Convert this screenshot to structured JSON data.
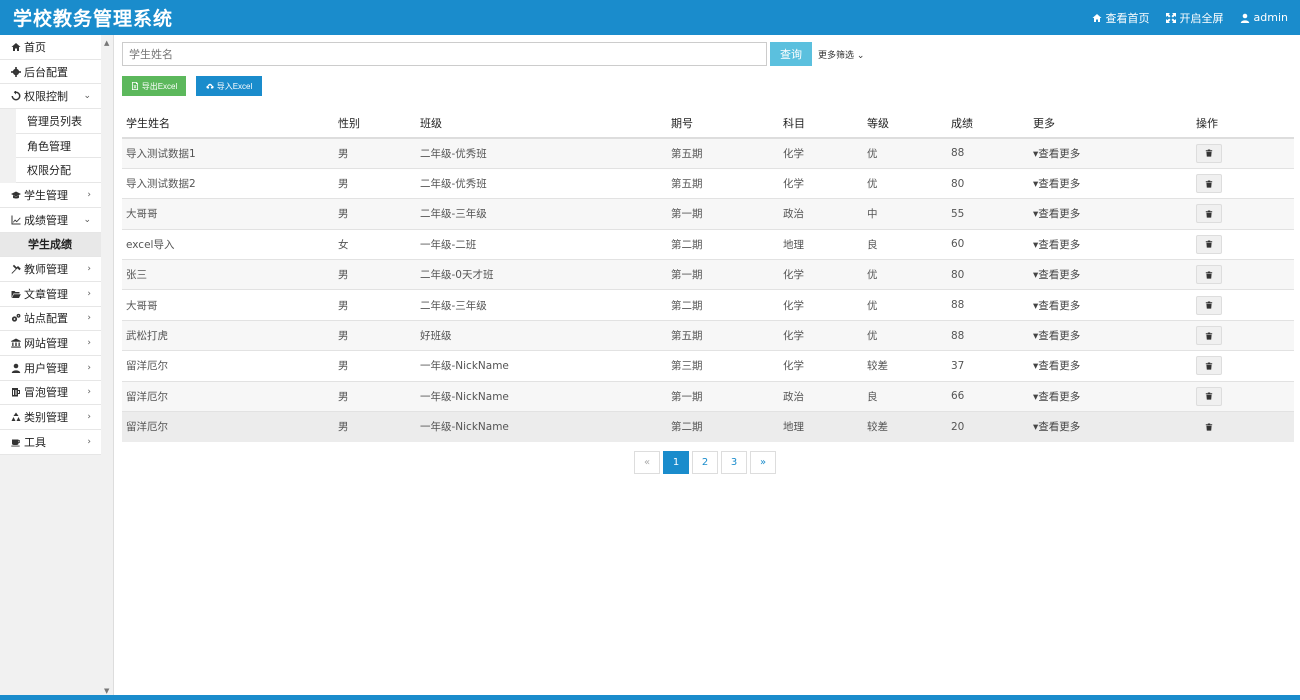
{
  "app": {
    "title": "学校教务管理系统"
  },
  "header": {
    "home_label": "查看首页",
    "fullscreen_label": "开启全屏",
    "user_label": "admin"
  },
  "sidebar": {
    "items": [
      {
        "label": "首页",
        "icon": "home-icon",
        "chevron": ""
      },
      {
        "label": "后台配置",
        "icon": "gear-icon",
        "chevron": ""
      },
      {
        "label": "权限控制",
        "icon": "recycle-icon",
        "chevron": "⌄"
      },
      {
        "label": "学生管理",
        "icon": "graduation-cap-icon",
        "chevron": "›"
      },
      {
        "label": "成绩管理",
        "icon": "line-chart-icon",
        "chevron": "⌄"
      },
      {
        "label": "教师管理",
        "icon": "gavel-icon",
        "chevron": "›"
      },
      {
        "label": "文章管理",
        "icon": "folder-open-icon",
        "chevron": "›"
      },
      {
        "label": "站点配置",
        "icon": "cogs-icon",
        "chevron": "›"
      },
      {
        "label": "网站管理",
        "icon": "bank-icon",
        "chevron": "›"
      },
      {
        "label": "用户管理",
        "icon": "user-icon",
        "chevron": "›"
      },
      {
        "label": "冒泡管理",
        "icon": "beer-icon",
        "chevron": "›"
      },
      {
        "label": "类别管理",
        "icon": "recycle-icon",
        "chevron": "›"
      },
      {
        "label": "工具",
        "icon": "coffee-icon",
        "chevron": "›"
      }
    ],
    "perm_sub": [
      "管理员列表",
      "角色管理",
      "权限分配"
    ],
    "score_sub": [
      "学生成绩"
    ]
  },
  "search": {
    "placeholder": "学生姓名",
    "query_label": "查询",
    "more_filter_label": "更多筛选 ⌄"
  },
  "actions": {
    "export_label": "导出Excel",
    "import_label": "导入Excel"
  },
  "table": {
    "headers": [
      "学生姓名",
      "性别",
      "班级",
      "期号",
      "科目",
      "等级",
      "成绩",
      "更多",
      "操作"
    ],
    "more_label": "查看更多",
    "rows": [
      [
        "导入测试数据1",
        "男",
        "二年级-优秀班",
        "第五期",
        "化学",
        "优",
        "88"
      ],
      [
        "导入测试数据2",
        "男",
        "二年级-优秀班",
        "第五期",
        "化学",
        "优",
        "80"
      ],
      [
        "大哥哥",
        "男",
        "二年级-三年级",
        "第一期",
        "政治",
        "中",
        "55"
      ],
      [
        "excel导入",
        "女",
        "一年级-二班",
        "第二期",
        "地理",
        "良",
        "60"
      ],
      [
        "张三",
        "男",
        "二年级-0天才班",
        "第一期",
        "化学",
        "优",
        "80"
      ],
      [
        "大哥哥",
        "男",
        "二年级-三年级",
        "第二期",
        "化学",
        "优",
        "88"
      ],
      [
        "武松打虎",
        "男",
        "好班级",
        "第五期",
        "化学",
        "优",
        "88"
      ],
      [
        "留洋厄尔",
        "男",
        "一年级-NickName",
        "第三期",
        "化学",
        "较差",
        "37"
      ],
      [
        "留洋厄尔",
        "男",
        "一年级-NickName",
        "第一期",
        "政治",
        "良",
        "66"
      ],
      [
        "留洋厄尔",
        "男",
        "一年级-NickName",
        "第二期",
        "地理",
        "较差",
        "20"
      ]
    ]
  },
  "pagination": {
    "prev": "«",
    "pages": [
      "1",
      "2",
      "3"
    ],
    "next": "»",
    "current": "1"
  },
  "colors": {
    "primary": "#1a8ccc",
    "success": "#5cb85c",
    "info": "#5bc0de"
  }
}
